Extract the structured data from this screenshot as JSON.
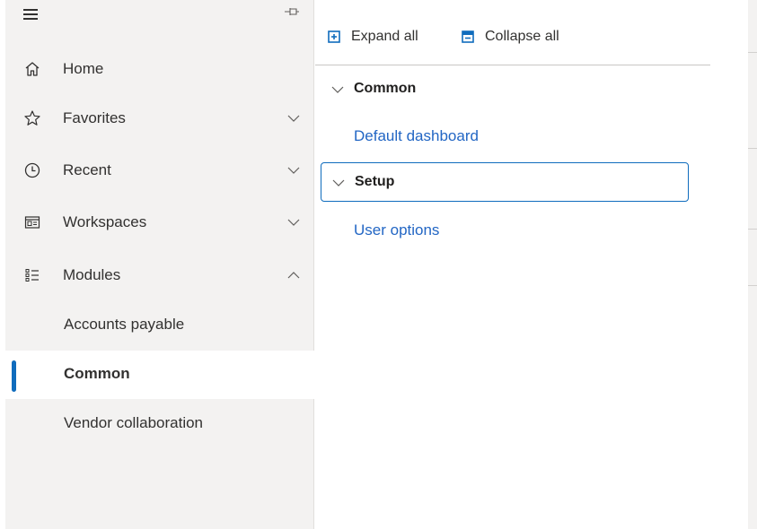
{
  "nav": {
    "items": [
      {
        "label": "Home",
        "icon": "home-icon"
      },
      {
        "label": "Favorites",
        "icon": "star-icon"
      },
      {
        "label": "Recent",
        "icon": "clock-icon"
      },
      {
        "label": "Workspaces",
        "icon": "workspaces-icon"
      },
      {
        "label": "Modules",
        "icon": "modules-icon"
      }
    ],
    "modules": [
      {
        "label": "Accounts payable",
        "selected": false
      },
      {
        "label": "Common",
        "selected": true
      },
      {
        "label": "Vendor collaboration",
        "selected": false
      }
    ]
  },
  "toolbar": {
    "expand_label": "Expand all",
    "collapse_label": "Collapse all"
  },
  "groups": [
    {
      "title": "Common",
      "links": [
        "Default dashboard"
      ]
    },
    {
      "title": "Setup",
      "links": [
        "User options"
      ]
    }
  ],
  "colors": {
    "accent": "#0f6cbd",
    "link": "#2266c4",
    "nav_bg": "#f3f2f1"
  }
}
